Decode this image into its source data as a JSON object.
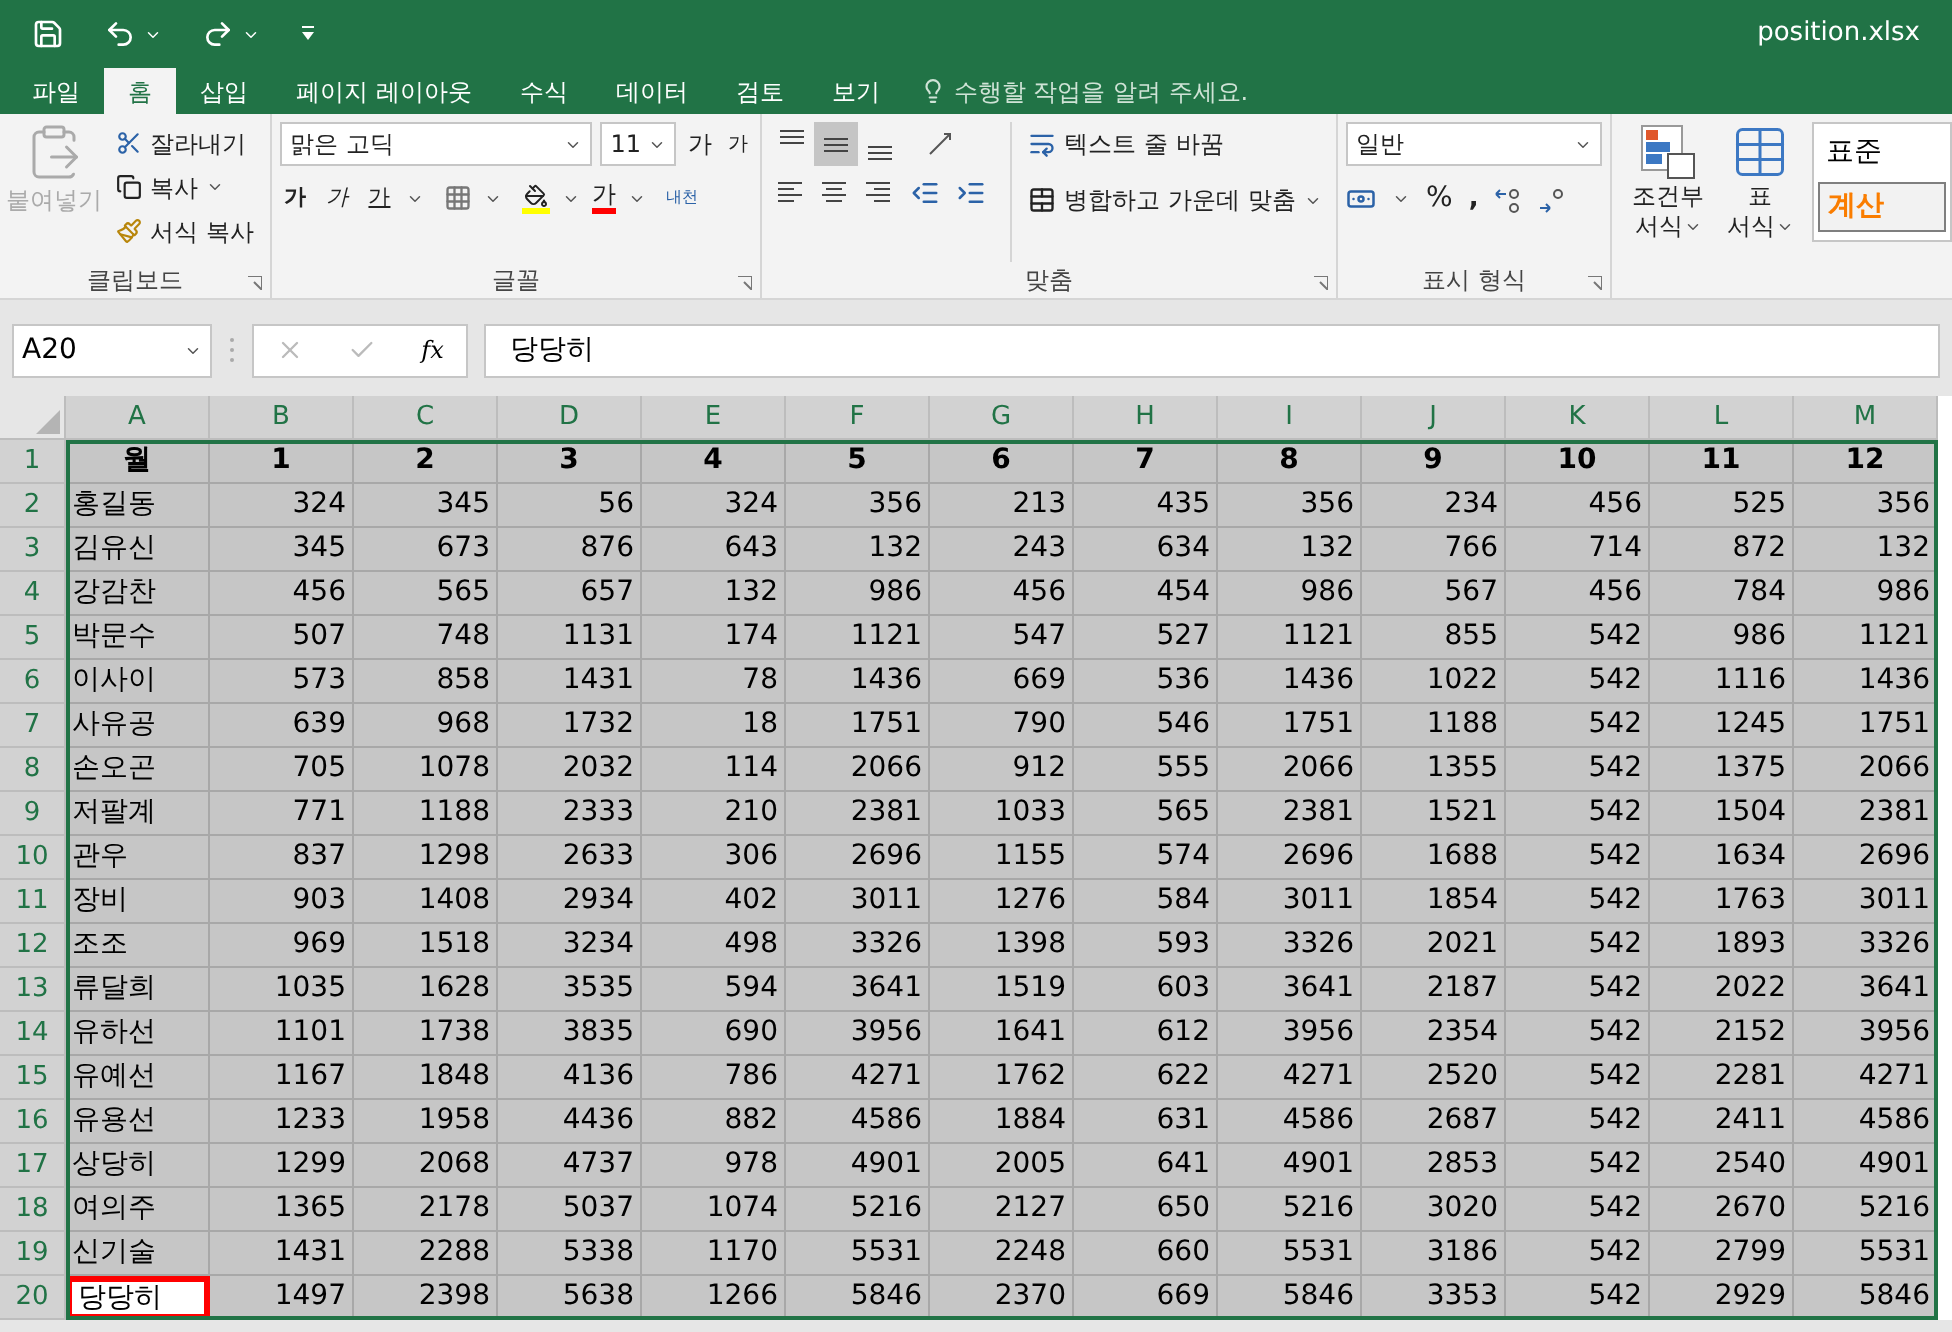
{
  "title_bar": {
    "file_name": "position.xlsx"
  },
  "tabs": [
    {
      "label": "파일",
      "selected": false
    },
    {
      "label": "홈",
      "selected": true
    },
    {
      "label": "삽입",
      "selected": false
    },
    {
      "label": "페이지 레이아웃",
      "selected": false
    },
    {
      "label": "수식",
      "selected": false
    },
    {
      "label": "데이터",
      "selected": false
    },
    {
      "label": "검토",
      "selected": false
    },
    {
      "label": "보기",
      "selected": false
    }
  ],
  "tell_me": {
    "placeholder": "수행할 작업을 알려 주세요."
  },
  "clipboard": {
    "label": "클립보드",
    "paste": {
      "label": "붙여넣기",
      "disabled": true
    },
    "items": [
      "잘라내기",
      "복사",
      "서식 복사"
    ]
  },
  "font": {
    "label": "글꼴",
    "font_name": "맑은 고딕",
    "font_size": "11",
    "grow": "가",
    "shrink": "가",
    "styles": [
      "가",
      "가",
      "가"
    ],
    "font_color": "가",
    "phonetic": "내천"
  },
  "alignment": {
    "label": "맞춤",
    "vertical_align": [
      {
        "selected": false
      },
      {
        "selected": true
      },
      {
        "selected": false
      }
    ],
    "wrap": "텍스트 줄 바꿈",
    "merge": "병합하고 가운데 맞춤"
  },
  "number": {
    "label": "표시 형식",
    "format": "일반",
    "percent": "%",
    "comma": ","
  },
  "styles": {
    "conditional": [
      "조건부",
      "서식"
    ],
    "table_format": [
      "표",
      "서식"
    ],
    "cell_styles": [
      {
        "label": "표준",
        "kind": "normal"
      },
      {
        "label": "계산",
        "kind": "calc"
      }
    ]
  },
  "formula_bar": {
    "name_box": "A20",
    "fx": "fx",
    "value": "당당히"
  },
  "sheet": {
    "range_selected": true,
    "columns": [
      "A",
      "B",
      "C",
      "D",
      "E",
      "F",
      "G",
      "H",
      "I",
      "J",
      "K",
      "L",
      "M"
    ],
    "rows": [
      {
        "number": "1",
        "cells": [
          "월",
          "1",
          "2",
          "3",
          "4",
          "5",
          "6",
          "7",
          "8",
          "9",
          "10",
          "11",
          "12"
        ],
        "active": false
      },
      {
        "number": "2",
        "cells": [
          "홍길동",
          "324",
          "345",
          "56",
          "324",
          "356",
          "213",
          "435",
          "356",
          "234",
          "456",
          "525",
          "356"
        ],
        "active": false
      },
      {
        "number": "3",
        "cells": [
          "김유신",
          "345",
          "673",
          "876",
          "643",
          "132",
          "243",
          "634",
          "132",
          "766",
          "714",
          "872",
          "132"
        ],
        "active": false
      },
      {
        "number": "4",
        "cells": [
          "강감찬",
          "456",
          "565",
          "657",
          "132",
          "986",
          "456",
          "454",
          "986",
          "567",
          "456",
          "784",
          "986"
        ],
        "active": false
      },
      {
        "number": "5",
        "cells": [
          "박문수",
          "507",
          "748",
          "1131",
          "174",
          "1121",
          "547",
          "527",
          "1121",
          "855",
          "542",
          "986",
          "1121"
        ],
        "active": false
      },
      {
        "number": "6",
        "cells": [
          "이사이",
          "573",
          "858",
          "1431",
          "78",
          "1436",
          "669",
          "536",
          "1436",
          "1022",
          "542",
          "1116",
          "1436"
        ],
        "active": false
      },
      {
        "number": "7",
        "cells": [
          "사유공",
          "639",
          "968",
          "1732",
          "18",
          "1751",
          "790",
          "546",
          "1751",
          "1188",
          "542",
          "1245",
          "1751"
        ],
        "active": false
      },
      {
        "number": "8",
        "cells": [
          "손오곤",
          "705",
          "1078",
          "2032",
          "114",
          "2066",
          "912",
          "555",
          "2066",
          "1355",
          "542",
          "1375",
          "2066"
        ],
        "active": false
      },
      {
        "number": "9",
        "cells": [
          "저팔계",
          "771",
          "1188",
          "2333",
          "210",
          "2381",
          "1033",
          "565",
          "2381",
          "1521",
          "542",
          "1504",
          "2381"
        ],
        "active": false
      },
      {
        "number": "10",
        "cells": [
          "관우",
          "837",
          "1298",
          "2633",
          "306",
          "2696",
          "1155",
          "574",
          "2696",
          "1688",
          "542",
          "1634",
          "2696"
        ],
        "active": false
      },
      {
        "number": "11",
        "cells": [
          "장비",
          "903",
          "1408",
          "2934",
          "402",
          "3011",
          "1276",
          "584",
          "3011",
          "1854",
          "542",
          "1763",
          "3011"
        ],
        "active": false
      },
      {
        "number": "12",
        "cells": [
          "조조",
          "969",
          "1518",
          "3234",
          "498",
          "3326",
          "1398",
          "593",
          "3326",
          "2021",
          "542",
          "1893",
          "3326"
        ],
        "active": false
      },
      {
        "number": "13",
        "cells": [
          "류달희",
          "1035",
          "1628",
          "3535",
          "594",
          "3641",
          "1519",
          "603",
          "3641",
          "2187",
          "542",
          "2022",
          "3641"
        ],
        "active": false
      },
      {
        "number": "14",
        "cells": [
          "유하선",
          "1101",
          "1738",
          "3835",
          "690",
          "3956",
          "1641",
          "612",
          "3956",
          "2354",
          "542",
          "2152",
          "3956"
        ],
        "active": false
      },
      {
        "number": "15",
        "cells": [
          "유예선",
          "1167",
          "1848",
          "4136",
          "786",
          "4271",
          "1762",
          "622",
          "4271",
          "2520",
          "542",
          "2281",
          "4271"
        ],
        "active": false
      },
      {
        "number": "16",
        "cells": [
          "유용선",
          "1233",
          "1958",
          "4436",
          "882",
          "4586",
          "1884",
          "631",
          "4586",
          "2687",
          "542",
          "2411",
          "4586"
        ],
        "active": false
      },
      {
        "number": "17",
        "cells": [
          "상당히",
          "1299",
          "2068",
          "4737",
          "978",
          "4901",
          "2005",
          "641",
          "4901",
          "2853",
          "542",
          "2540",
          "4901"
        ],
        "active": false
      },
      {
        "number": "18",
        "cells": [
          "여의주",
          "1365",
          "2178",
          "5037",
          "1074",
          "5216",
          "2127",
          "650",
          "5216",
          "3020",
          "542",
          "2670",
          "5216"
        ],
        "active": false
      },
      {
        "number": "19",
        "cells": [
          "신기술",
          "1431",
          "2288",
          "5338",
          "1170",
          "5531",
          "2248",
          "660",
          "5531",
          "3186",
          "542",
          "2799",
          "5531"
        ],
        "active": false
      },
      {
        "number": "20",
        "cells": [
          "당당히",
          "1497",
          "2398",
          "5638",
          "1266",
          "5846",
          "2370",
          "669",
          "5846",
          "3353",
          "542",
          "2929",
          "5846"
        ],
        "active": true
      }
    ]
  }
}
